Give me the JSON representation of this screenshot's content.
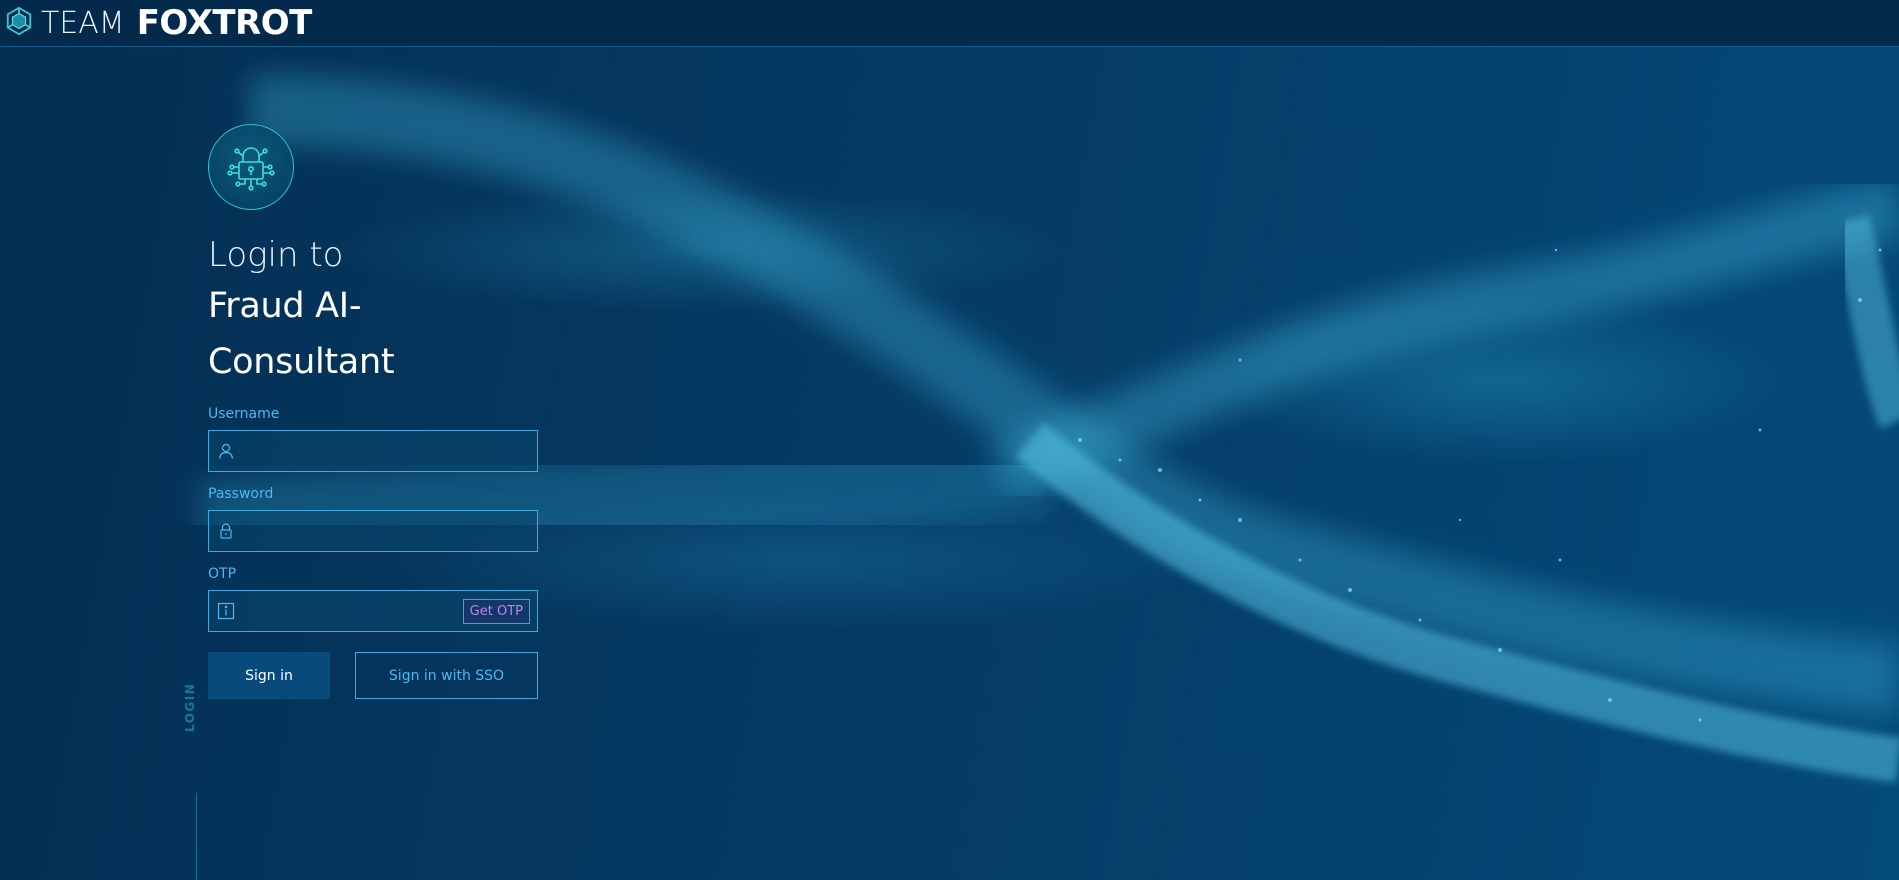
{
  "header": {
    "brand_light": "TEAM",
    "brand_bold": "FOXTROT",
    "logo_icon": "hexagon-cube-logo-icon"
  },
  "login": {
    "badge_icon": "circuit-lock-icon",
    "title_line1": "Login to",
    "title_line2": "Fraud AI-Consultant",
    "username": {
      "label": "Username",
      "value": "",
      "placeholder": "",
      "icon": "user-icon"
    },
    "password": {
      "label": "Password",
      "value": "",
      "placeholder": "",
      "icon": "lock-icon"
    },
    "otp": {
      "label": "OTP",
      "value": "",
      "placeholder": "",
      "icon": "info-icon",
      "button_label": "Get OTP"
    },
    "sign_in_label": "Sign in",
    "sso_label": "Sign in with SSO"
  },
  "side_tag": "LOGIN",
  "colors": {
    "accent": "#3ea9e0",
    "badge_ring": "#25c7c2",
    "otp_button": "#b985f0",
    "primary_button": "#074a7c",
    "background": "#05335a"
  }
}
